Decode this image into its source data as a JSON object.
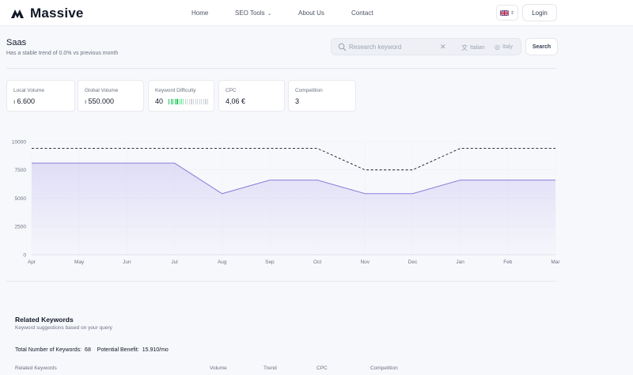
{
  "header": {
    "brand": "Massive",
    "nav": [
      {
        "label": "Home"
      },
      {
        "label": "SEO Tools",
        "has_dropdown": true
      },
      {
        "label": "About Us"
      },
      {
        "label": "Contact"
      }
    ],
    "login_label": "Login",
    "flag": "uk-flag-icon"
  },
  "keyword": {
    "title": "Saas",
    "trend_text": "Has a stable trend of 0.0% vs previous month"
  },
  "search": {
    "placeholder": "Research keyword",
    "language": "Italian",
    "country": "Italy",
    "button_label": "Search"
  },
  "metrics": [
    {
      "label": "Local Volume",
      "value": "6.600",
      "icon": "bar-chart-icon"
    },
    {
      "label": "Global Volume",
      "value": "550.000",
      "icon": "bar-chart-icon"
    },
    {
      "label": "Keyword Difficulty",
      "value": "40",
      "difficulty": 40
    },
    {
      "label": "CPC",
      "value": "4,06 €"
    },
    {
      "label": "Competition",
      "value": "3"
    }
  ],
  "chart_data": {
    "type": "line",
    "x": [
      "Apr",
      "May",
      "Jun",
      "Jul",
      "Aug",
      "Sep",
      "Oct",
      "Nov",
      "Dec",
      "Jan",
      "Feb",
      "Mar"
    ],
    "yticks": [
      0,
      2500,
      5000,
      7500,
      10000
    ],
    "ylim": [
      0,
      10000
    ],
    "series": [
      {
        "values": [
          8100,
          8100,
          8100,
          8100,
          5400,
          6600,
          6600,
          5400,
          5400,
          6600,
          6600,
          6600
        ],
        "style": "solid-area",
        "color": "#8b7fd6"
      },
      {
        "values": [
          9400,
          9400,
          9400,
          9400,
          9400,
          9400,
          9400,
          7500,
          7500,
          9400,
          9400,
          9400
        ],
        "style": "dashed",
        "color": "#111827"
      }
    ],
    "grid": true
  },
  "related": {
    "title": "Related Keywords",
    "subtitle": "Keyword suggestions based on your query",
    "total_label": "Total Number of Keywords:",
    "total_value": "68",
    "benefit_label": "Potential Benefit:",
    "benefit_value": "15.910/mo",
    "columns": [
      "Related Keywords",
      "Volume",
      "Trend",
      "CPC",
      "Competition"
    ]
  }
}
